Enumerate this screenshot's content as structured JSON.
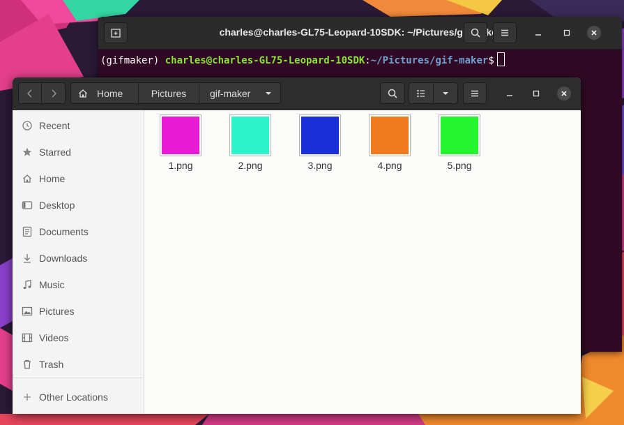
{
  "terminal": {
    "title": "charles@charles-GL75-Leopard-10SDK: ~/Pictures/gif-maker",
    "prompt_env": "(gifmaker) ",
    "prompt_user": "charles@charles-GL75-Leopard-10SDK",
    "prompt_colon": ":",
    "prompt_path": "~/Pictures/gif-maker",
    "prompt_symbol": "$"
  },
  "files": {
    "breadcrumbs": [
      "Home",
      "Pictures",
      "gif-maker"
    ],
    "sidebar": [
      {
        "label": "Recent",
        "icon": "clock-icon"
      },
      {
        "label": "Starred",
        "icon": "star-icon"
      },
      {
        "label": "Home",
        "icon": "home-icon"
      },
      {
        "label": "Desktop",
        "icon": "desktop-icon"
      },
      {
        "label": "Documents",
        "icon": "document-icon"
      },
      {
        "label": "Downloads",
        "icon": "download-icon"
      },
      {
        "label": "Music",
        "icon": "music-icon"
      },
      {
        "label": "Pictures",
        "icon": "picture-icon"
      },
      {
        "label": "Videos",
        "icon": "film-icon"
      },
      {
        "label": "Trash",
        "icon": "trash-icon"
      },
      {
        "label": "Other Locations",
        "icon": "plus-icon"
      }
    ],
    "items": [
      {
        "name": "1.png",
        "color": "#e81ad6"
      },
      {
        "name": "2.png",
        "color": "#2ef2c9"
      },
      {
        "name": "3.png",
        "color": "#1a2fd8"
      },
      {
        "name": "4.png",
        "color": "#f07a1e"
      },
      {
        "name": "5.png",
        "color": "#24f52f"
      }
    ]
  },
  "colors": {
    "terminal_bg": "#300a24",
    "prompt_user": "#8ae234",
    "prompt_path": "#729fcf"
  }
}
